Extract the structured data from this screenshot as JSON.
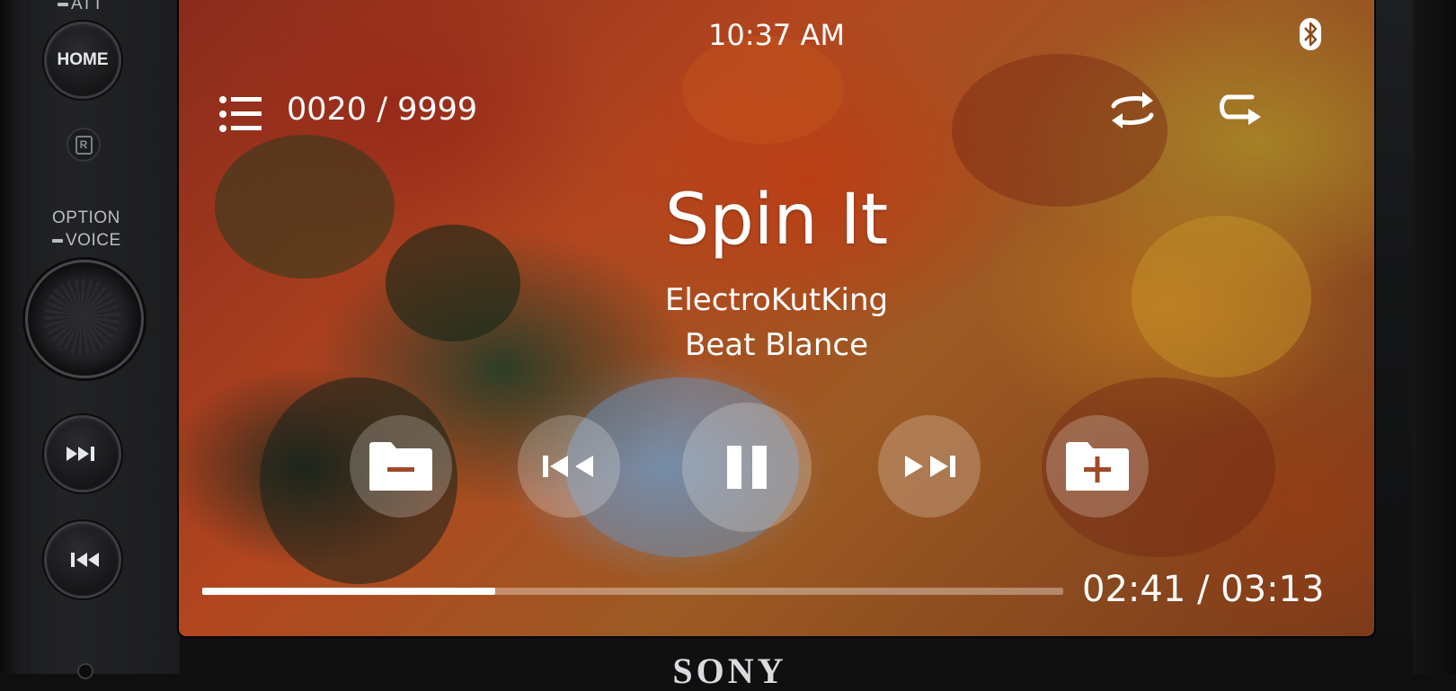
{
  "hardware": {
    "att_label": "ATT",
    "home_label": "HOME",
    "option_label": "OPTION",
    "voice_label": "VOICE",
    "brand": "SONY"
  },
  "status_bar": {
    "time": "10:37 AM",
    "bluetooth_icon": "bluetooth-icon"
  },
  "player": {
    "track_counter": "0020 / 9999",
    "title": "Spin It",
    "artist": "ElectroKutKing",
    "album": "Beat Blance",
    "elapsed_fraction": 0.34,
    "time_readout": "02:41 / 03:13",
    "controls": {
      "list": "list-icon",
      "shuffle": "shuffle-icon",
      "repeat": "repeat-icon",
      "folder_down": "folder-minus-icon",
      "previous": "previous-track-icon",
      "pause": "pause-icon",
      "next": "next-track-icon",
      "folder_up": "folder-plus-icon"
    }
  },
  "colors": {
    "text": "#ffffff",
    "control_bg": "rgba(255,255,255,0.22)",
    "progress_track": "rgba(255,255,255,0.35)"
  }
}
